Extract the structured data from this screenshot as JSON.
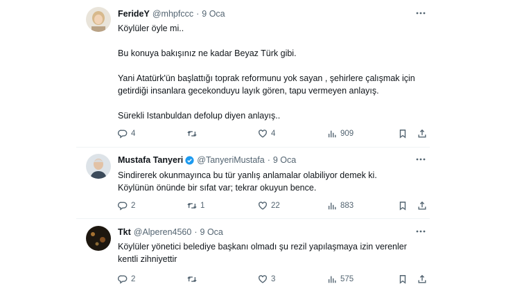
{
  "tweets": [
    {
      "name": "FerideY",
      "handle": "@mhpfccc",
      "sep": "·",
      "time": "9 Oca",
      "text": "Köylüler öyle mi..\n\nBu konuya bakışınız ne kadar Beyaz Türk gibi.\n\nYani Atatürk'ün başlattığı toprak reformunu  yok sayan , şehirlere çalışmak için getirdiği insanlara  gecekonduyu layık gören, tapu vermeyen anlayış.\n\nSürekli Istanbuldan defolup diyen anlayış..",
      "replies": "4",
      "retweets": "",
      "likes": "4",
      "views": "909",
      "avatar_color": "#d7c39a"
    },
    {
      "name": "Mustafa Tanyeri",
      "handle": "@TanyeriMustafa",
      "sep": "·",
      "time": "9 Oca",
      "text": "Sindirerek okunmayınca bu tür yanlış anlamalar olabiliyor demek ki.\nKöylünün önünde bir sıfat var; tekrar okuyun bence.",
      "replies": "2",
      "retweets": "1",
      "likes": "22",
      "views": "883",
      "avatar_color": "#cfd4da"
    },
    {
      "name": "Tkt",
      "handle": "@Alperen4560",
      "sep": "·",
      "time": "9 Oca",
      "text": "Köylüler yönetici belediye başkanı olmadı şu rezil yapılaşmaya izin verenler\nkentli zihniyettir",
      "replies": "2",
      "retweets": "",
      "likes": "3",
      "views": "575",
      "avatar_color": "#2a2014"
    }
  ],
  "colors": {
    "text": "#0f1419",
    "secondary": "#536471",
    "verified": "#1d9bf0",
    "divider": "#eff3f4"
  },
  "icons": [
    "reply-icon",
    "retweet-icon",
    "like-icon",
    "views-icon",
    "bookmark-icon",
    "share-icon",
    "more-icon",
    "verified-icon"
  ]
}
